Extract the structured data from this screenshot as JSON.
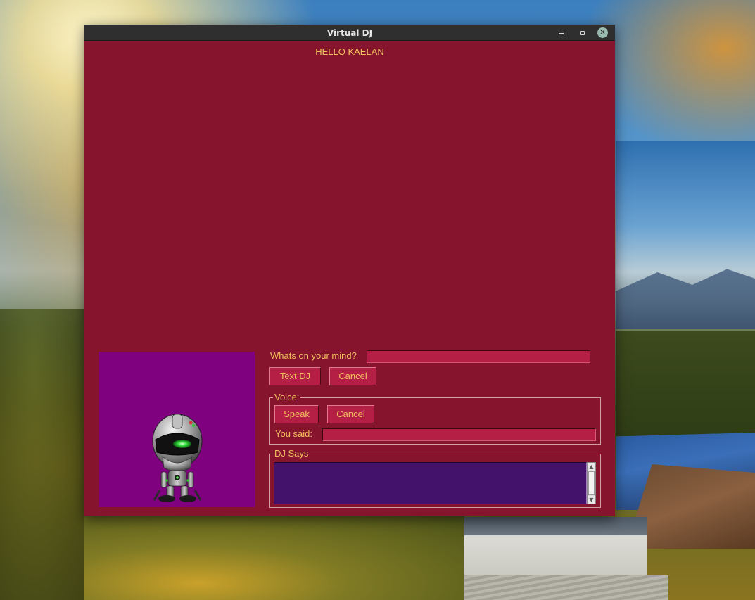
{
  "window": {
    "title": "Virtual DJ",
    "controls": {
      "minimize": "minimize-icon",
      "maximize": "maximize-icon",
      "close": "close-icon"
    }
  },
  "greeting": "HELLO KAELAN",
  "text_input": {
    "label": "Whats on your mind?",
    "value": "",
    "text_button": "Text DJ",
    "cancel_button": "Cancel"
  },
  "voice": {
    "legend": "Voice:",
    "speak_button": "Speak",
    "cancel_button": "Cancel",
    "you_said_label": "You said:",
    "you_said_value": ""
  },
  "dj_says": {
    "legend": "DJ Says",
    "text": ""
  },
  "colors": {
    "window_bg": "#85142c",
    "accent_text": "#f0c060",
    "button_bg": "#b51f45",
    "robot_panel": "#7f017f",
    "dj_text_bg": "#43136b"
  }
}
